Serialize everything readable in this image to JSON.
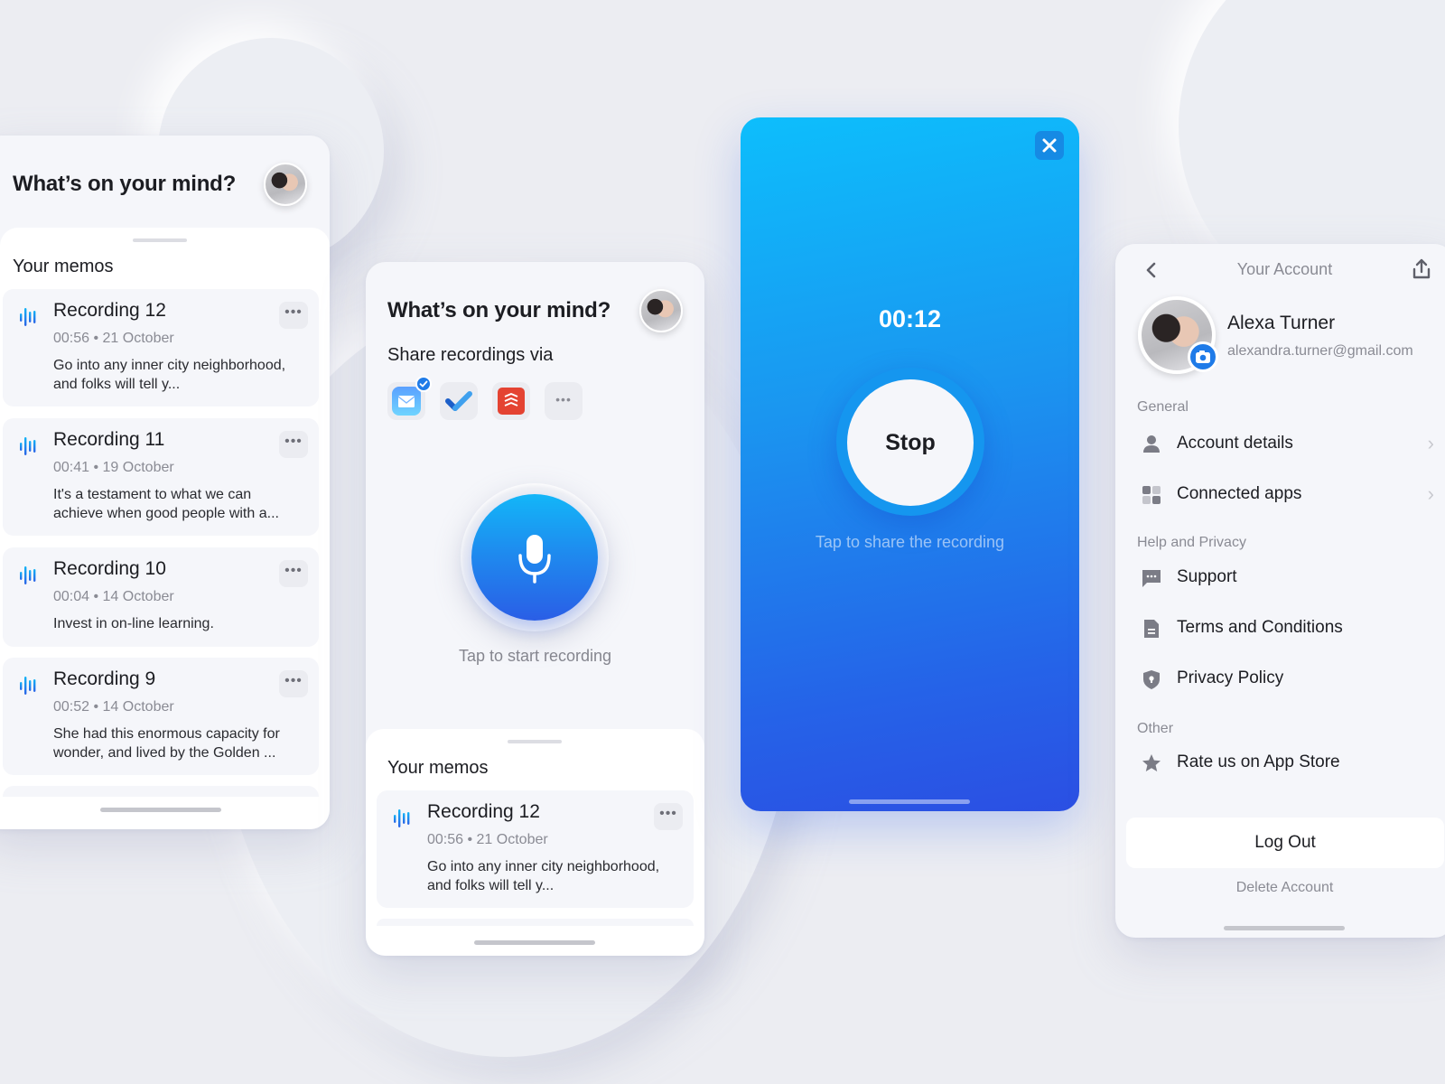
{
  "colors": {
    "background": "#ecedf2",
    "accent_blue": "#1a8cf0",
    "gradient_top": "#0dbefc",
    "gradient_bottom": "#2b4fe3",
    "muted_text": "#8a8b94",
    "todoist_red": "#e44332"
  },
  "screen_left": {
    "title": "What’s on your mind?",
    "memos_title": "Your memos",
    "memos": [
      {
        "name": "Recording 12",
        "meta": "00:56 • 21 October",
        "desc": "Go into any inner city neighborhood, and folks will tell y..."
      },
      {
        "name": "Recording 11",
        "meta": "00:41 • 19 October",
        "desc": "It's a testament to what we can achieve when good people with a..."
      },
      {
        "name": "Recording 10",
        "meta": "00:04 • 14 October",
        "desc": "Invest in on-line learning."
      },
      {
        "name": "Recording 9",
        "meta": "00:52 • 14 October",
        "desc": "She had this enormous capacity for wonder, and lived by the Golden ..."
      }
    ],
    "more_label": "•••"
  },
  "screen_home": {
    "title": "What’s on your mind?",
    "share_label": "Share recordings via",
    "share_apps": [
      {
        "name": "mail-app",
        "icon": "envelope",
        "selected": true
      },
      {
        "name": "microsoft-todo-app",
        "icon": "checkmark",
        "selected": false
      },
      {
        "name": "todoist-app",
        "icon": "stacked-chevrons",
        "selected": false
      },
      {
        "name": "more-apps",
        "icon": "ellipsis",
        "selected": false
      }
    ],
    "more_label": "•••",
    "record_hint": "Tap to start recording",
    "memos_title": "Your memos",
    "memos": [
      {
        "name": "Recording 12",
        "meta": "00:56 • 21 October",
        "desc": "Go into any inner city neighborhood, and folks will tell y..."
      }
    ]
  },
  "screen_recording": {
    "timer": "00:12",
    "stop_label": "Stop",
    "hint": "Tap to share the recording",
    "close_icon": "×"
  },
  "screen_account": {
    "header_title": "Your Account",
    "back_icon": "‹",
    "user_name": "Alexa Turner",
    "user_email": "alexandra.turner@gmail.com",
    "groups": [
      {
        "label": "General",
        "items": [
          {
            "label": "Account details",
            "icon": "person",
            "chevron": true
          },
          {
            "label": "Connected apps",
            "icon": "grid",
            "chevron": true
          }
        ]
      },
      {
        "label": "Help and Privacy",
        "items": [
          {
            "label": "Support",
            "icon": "chat-bubble",
            "chevron": false
          },
          {
            "label": "Terms and Conditions",
            "icon": "document",
            "chevron": false
          },
          {
            "label": "Privacy Policy",
            "icon": "shield",
            "chevron": false
          }
        ]
      },
      {
        "label": "Other",
        "items": [
          {
            "label": "Rate us on App Store",
            "icon": "star",
            "chevron": false
          }
        ]
      }
    ],
    "chevron_icon": "›",
    "logout_label": "Log Out",
    "delete_label": "Delete Account"
  }
}
